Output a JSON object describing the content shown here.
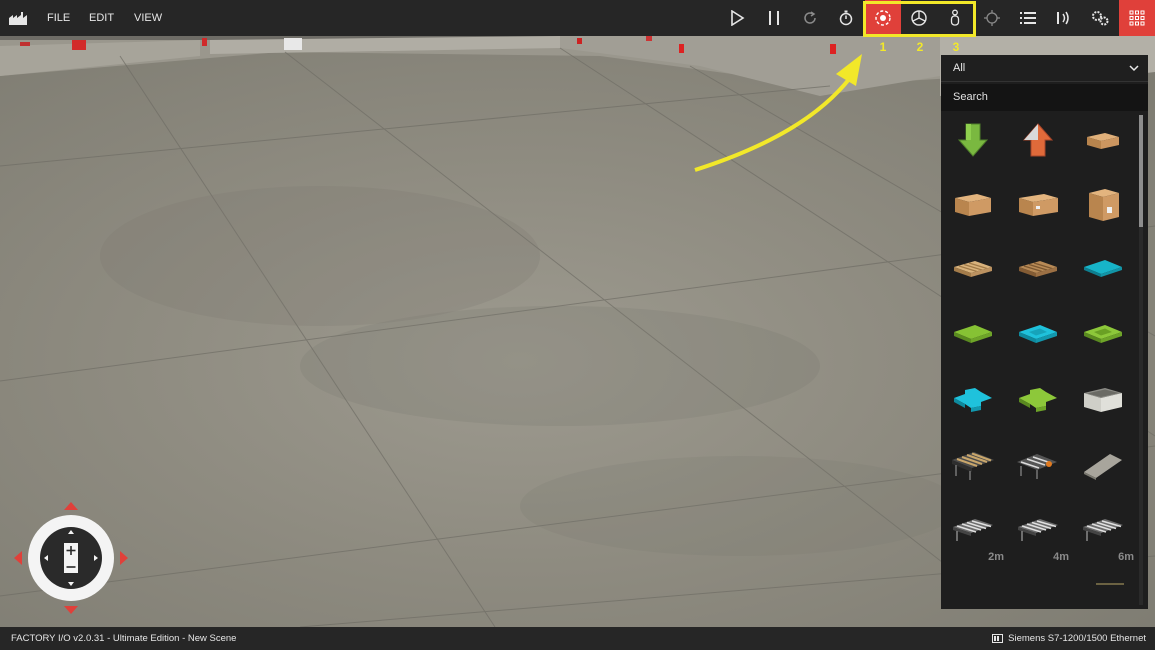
{
  "app": {
    "menu": [
      "FILE",
      "EDIT",
      "VIEW"
    ]
  },
  "toolbar": {
    "buttons": [
      {
        "name": "play",
        "icon": "play-icon"
      },
      {
        "name": "pause",
        "icon": "pause-icon"
      },
      {
        "name": "reset",
        "icon": "reset-icon"
      },
      {
        "name": "timer",
        "icon": "stopwatch-icon"
      },
      {
        "name": "orbit-camera",
        "icon": "orbit-camera-icon",
        "active": true
      },
      {
        "name": "fly-camera",
        "icon": "fly-camera-icon"
      },
      {
        "name": "first-person-camera",
        "icon": "first-person-icon"
      },
      {
        "name": "target",
        "icon": "crosshair-icon"
      },
      {
        "name": "tags",
        "icon": "list-icon"
      },
      {
        "name": "drivers",
        "icon": "signal-icon"
      },
      {
        "name": "settings",
        "icon": "gears-icon"
      },
      {
        "name": "catalog",
        "icon": "grid-icon",
        "active": true
      }
    ],
    "accent_color": "#e0403a"
  },
  "annotation": {
    "numbers": [
      "1",
      "2",
      "3"
    ],
    "color": "#f2e829"
  },
  "panel": {
    "filter": "All",
    "search_placeholder": "Search",
    "items": [
      {
        "name": "emitter",
        "icon": "green-down-arrow-icon"
      },
      {
        "name": "remover",
        "icon": "orange-up-arrow-icon"
      },
      {
        "name": "small-box",
        "icon": "small-box-icon"
      },
      {
        "name": "medium-box",
        "icon": "box-icon"
      },
      {
        "name": "large-box",
        "icon": "box-icon"
      },
      {
        "name": "tall-box",
        "icon": "tall-box-icon"
      },
      {
        "name": "pallet",
        "icon": "pallet-icon"
      },
      {
        "name": "pallet-dark",
        "icon": "pallet-icon"
      },
      {
        "name": "blue-plate",
        "icon": "blue-plate-icon"
      },
      {
        "name": "green-plate",
        "icon": "green-plate-icon"
      },
      {
        "name": "blue-lid",
        "icon": "blue-lid-icon"
      },
      {
        "name": "green-lid",
        "icon": "green-lid-icon"
      },
      {
        "name": "blue-base",
        "icon": "blue-base-icon"
      },
      {
        "name": "green-base",
        "icon": "green-base-icon"
      },
      {
        "name": "stackable-box",
        "icon": "crate-icon"
      },
      {
        "name": "roller-conveyor",
        "icon": "conveyor-icon"
      },
      {
        "name": "chain-transfer",
        "icon": "conveyor-icon"
      },
      {
        "name": "ramp",
        "icon": "ramp-icon"
      },
      {
        "name": "roller-2m",
        "icon": "roller-icon",
        "label": "2m"
      },
      {
        "name": "roller-4m",
        "icon": "roller-icon",
        "label": "4m"
      },
      {
        "name": "roller-6m",
        "icon": "roller-icon",
        "label": "6m"
      }
    ]
  },
  "status": {
    "left": "FACTORY I/O v2.0.31 - Ultimate Edition - New Scene",
    "driver": "Siemens S7-1200/1500 Ethernet"
  }
}
